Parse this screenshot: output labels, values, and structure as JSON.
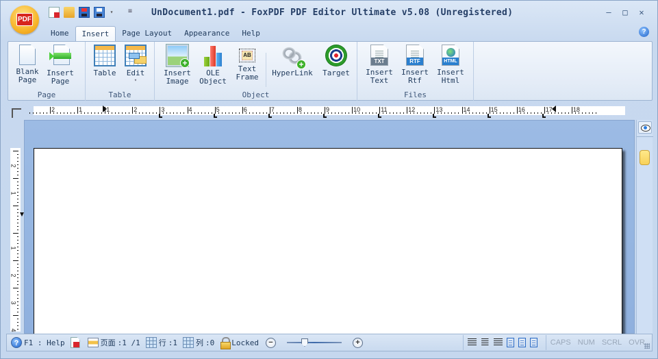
{
  "app": {
    "title": "UnDocument1.pdf - FoxPDF PDF Editor Ultimate v5.08 (Unregistered)",
    "logo_text": "PDF"
  },
  "quick_access": [
    {
      "name": "new-document",
      "icon": "new-pdf-icon"
    },
    {
      "name": "open",
      "icon": "folder-open-icon"
    },
    {
      "name": "save",
      "icon": "save-icon"
    },
    {
      "name": "save-as",
      "icon": "save-as-icon"
    }
  ],
  "window_controls": {
    "minimize": "▭",
    "restore": "▣",
    "close": "✕"
  },
  "help_glyph": "?",
  "tabs": [
    {
      "label": "Home",
      "active": false
    },
    {
      "label": "Insert",
      "active": true
    },
    {
      "label": "Page Layout",
      "active": false
    },
    {
      "label": "Appearance",
      "active": false
    },
    {
      "label": "Help",
      "active": false
    }
  ],
  "ribbon": {
    "groups": [
      {
        "label": "Page",
        "buttons": [
          {
            "label": "Blank\nPage"
          },
          {
            "label": "Insert\nPage"
          }
        ]
      },
      {
        "label": "Table",
        "buttons": [
          {
            "label": "Table"
          },
          {
            "label": "Edit",
            "dropdown": "▾"
          }
        ]
      },
      {
        "label": "Object",
        "buttons": [
          {
            "label": "Insert\nImage"
          },
          {
            "label": "OLE\nObject"
          },
          {
            "label": "Text\nFrame"
          },
          {
            "label": "HyperLink"
          },
          {
            "label": "Target"
          }
        ]
      },
      {
        "label": "Files",
        "buttons": [
          {
            "label": "Insert\nText",
            "badge": "TXT"
          },
          {
            "label": "Insert\nRtf",
            "badge": "RTF"
          },
          {
            "label": "Insert\nHtml",
            "badge": "HTML"
          }
        ]
      }
    ],
    "text_frame_glyph": "AB"
  },
  "ruler": {
    "horizontal_labels": [
      "2",
      "1",
      "1",
      "2",
      "3",
      "4",
      "5",
      "6",
      "7",
      "8",
      "9",
      "10",
      "11",
      "12",
      "13",
      "14",
      "15",
      "16",
      "17",
      "18"
    ],
    "vertical_labels": [
      "2",
      "1",
      "1",
      "2",
      "3",
      "4"
    ]
  },
  "status": {
    "help": "F1 : Help",
    "page_label": "页面",
    "page_value": ":1 /1",
    "row_label": "行",
    "row_value": ":1",
    "col_label": "列",
    "col_value": ":0",
    "lock": "Locked",
    "zoom_minus": "−",
    "zoom_plus": "+",
    "zoom_level_fraction": 0.3,
    "indicators": [
      "CAPS",
      "NUM",
      "SCRL",
      "OVR"
    ]
  },
  "colors": {
    "frame": "#c5d7ee",
    "canvas": "#9cbbe4",
    "accent": "#1d62c9"
  }
}
